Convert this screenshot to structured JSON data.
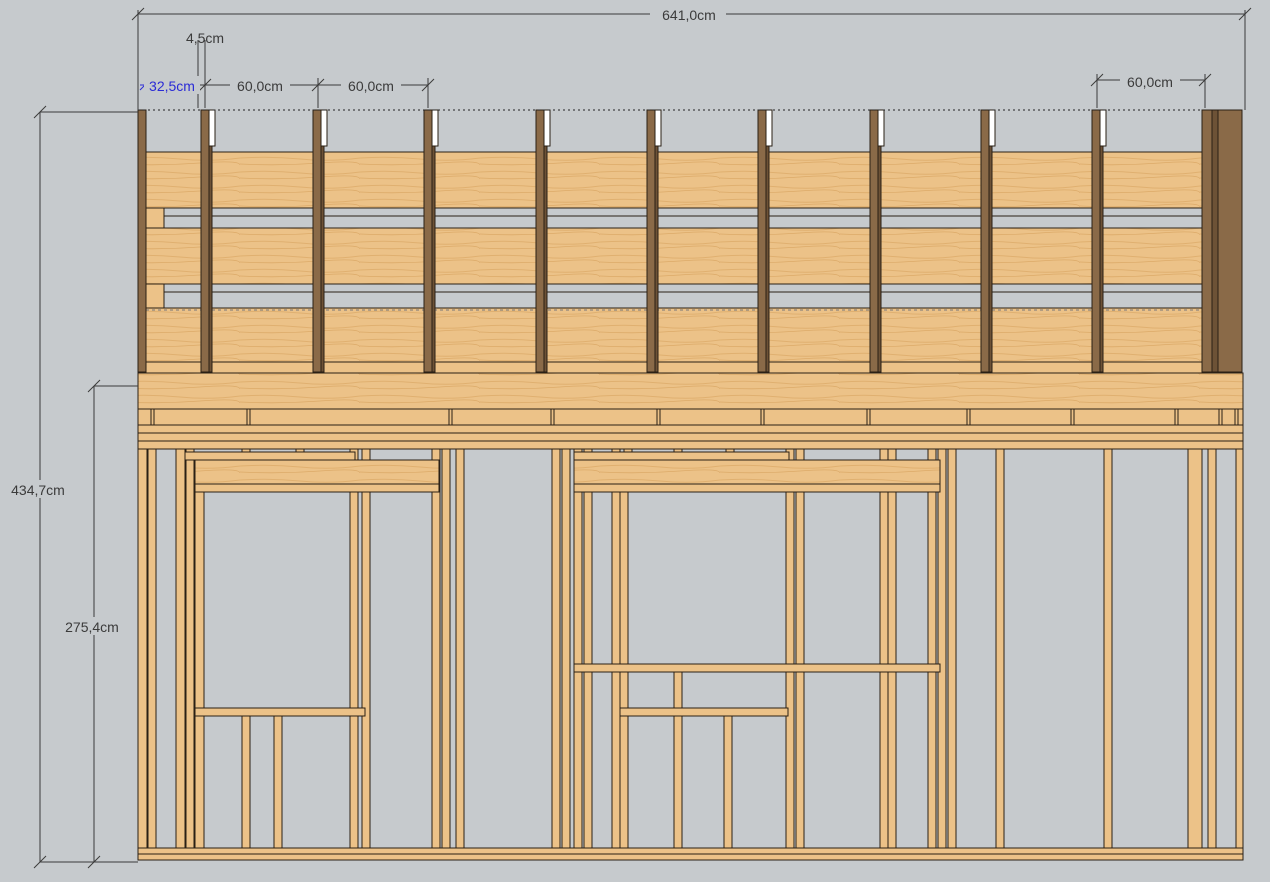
{
  "drawing": {
    "background": "#c6cacd",
    "wood_color": "#ecc288",
    "wood_dark": "#8a6a48",
    "wood_edge": "#2a2015",
    "dim_color": "#3b3b3b",
    "dim_selected_color": "#2b2bd6"
  },
  "dimensions": {
    "total_width": "641,0cm",
    "stud_width": "4,5cm",
    "first_offset": "32,5cm",
    "spacing_1": "60,0cm",
    "spacing_2": "60,0cm",
    "spacing_last": "60,0cm",
    "total_height": "434,7cm",
    "wall_height": "275,4cm"
  }
}
